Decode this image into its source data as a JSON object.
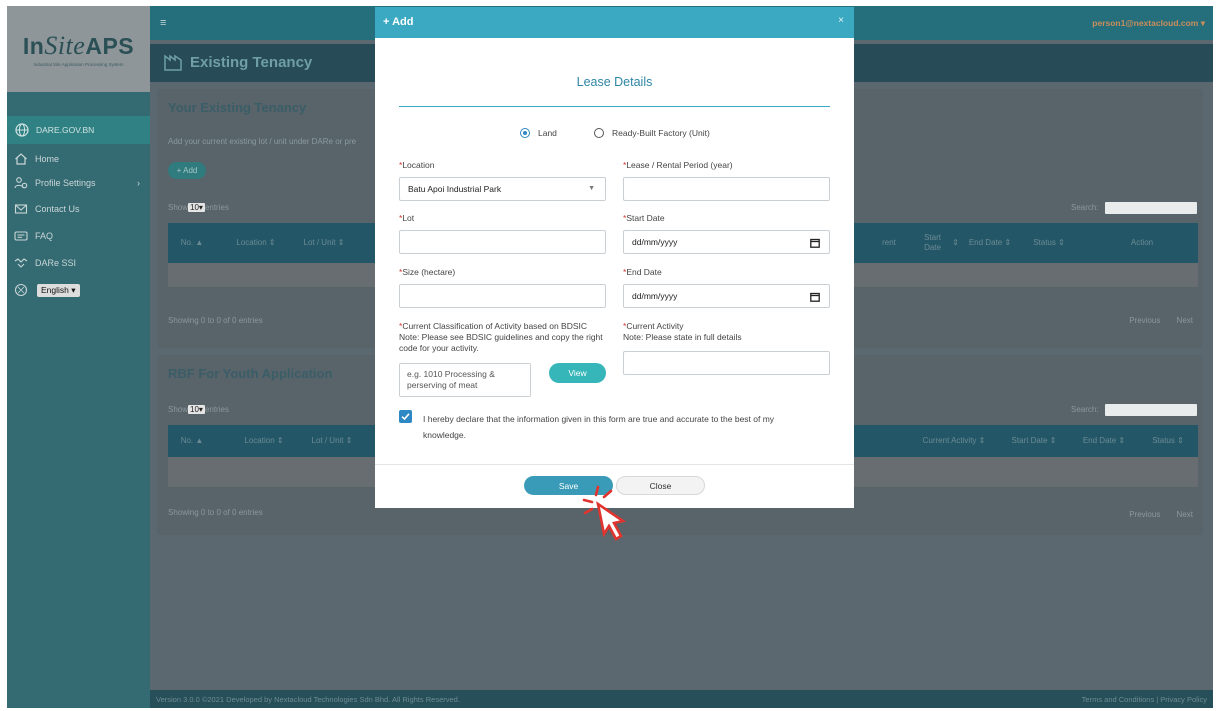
{
  "app": {
    "logo_prefix": "In",
    "logo_mid": "Site",
    "logo_suffix": "APS",
    "logo_sub": "Industrial Site Application Processing System",
    "user_email": "person1@nextacloud.com",
    "page_title": "Existing Tenancy"
  },
  "sidebar": {
    "brand": "DARE.GOV.BN",
    "items": [
      {
        "label": "Home",
        "icon": "home-icon"
      },
      {
        "label": "Profile Settings",
        "icon": "users-icon"
      },
      {
        "label": "Contact Us",
        "icon": "mail-icon"
      },
      {
        "label": "FAQ",
        "icon": "faq-icon"
      },
      {
        "label": "DARe SSI",
        "icon": "handshake-icon"
      }
    ],
    "language": "English"
  },
  "card1": {
    "title": "Your Existing Tenancy",
    "desc": "Add your current existing lot / unit under DARe or pre",
    "add_label": "+ Add",
    "show_prefix": "Show",
    "show_value": "10",
    "show_suffix": "entries",
    "search_label": "Search:",
    "columns_left": [
      "No.",
      "Location",
      "Lot / Unit"
    ],
    "columns_right": [
      "rent",
      "Start Date",
      "End Date",
      "Status",
      "Action"
    ],
    "showing": "Showing 0 to 0 of 0 entries",
    "prev": "Previous",
    "next": "Next"
  },
  "card2": {
    "title": "RBF For Youth Application",
    "show_prefix": "Show",
    "show_value": "10",
    "show_suffix": "entries",
    "search_label": "Search:",
    "columns_left": [
      "No.",
      "Location",
      "Lot / Unit"
    ],
    "columns_right": [
      "Current Activity",
      "Start Date",
      "End Date",
      "Status"
    ],
    "showing": "Showing 0 to 0 of 0 entries",
    "prev": "Previous",
    "next": "Next"
  },
  "footer": {
    "left": "Version 3.0.0 ©2021 Developed by Nextacloud Technologies Sdn Bhd. All Rights Reserved.",
    "right": "Terms and Conditions | Privacy Policy"
  },
  "modal": {
    "title": "+ Add",
    "close": "×",
    "heading": "Lease Details",
    "radio_land": "Land",
    "radio_factory": "Ready-Built Factory (Unit)",
    "location_label": "Location",
    "location_value": "Batu Apoi Industrial Park",
    "period_label": "Lease / Rental Period (year)",
    "lot_label": "Lot",
    "start_label": "Start Date",
    "date_placeholder": "dd/mm/yyyy",
    "size_label": "Size (hectare)",
    "end_label": "End Date",
    "bdsic_label_1": "Current Classification of Activity based on BDSIC",
    "bdsic_label_2": "Note: Please see BDSIC guidelines and copy the right",
    "bdsic_label_3": "code for your activity.",
    "bdsic_placeholder": "e.g. 1010 Processing & perserving of meat",
    "view_label": "View",
    "activity_label": "Current Activity",
    "activity_note": "Note: Please state in full details",
    "declare": "I hereby declare that the information given in this form are true and accurate to the best of my knowledge.",
    "save": "Save",
    "close_label": "Close"
  },
  "colors": {
    "modal_header": "#3aa9c1",
    "save_button": "#3a9bb8",
    "view_button": "#36b6b8",
    "required": "#d9342b",
    "cursor": "#e0342f"
  }
}
